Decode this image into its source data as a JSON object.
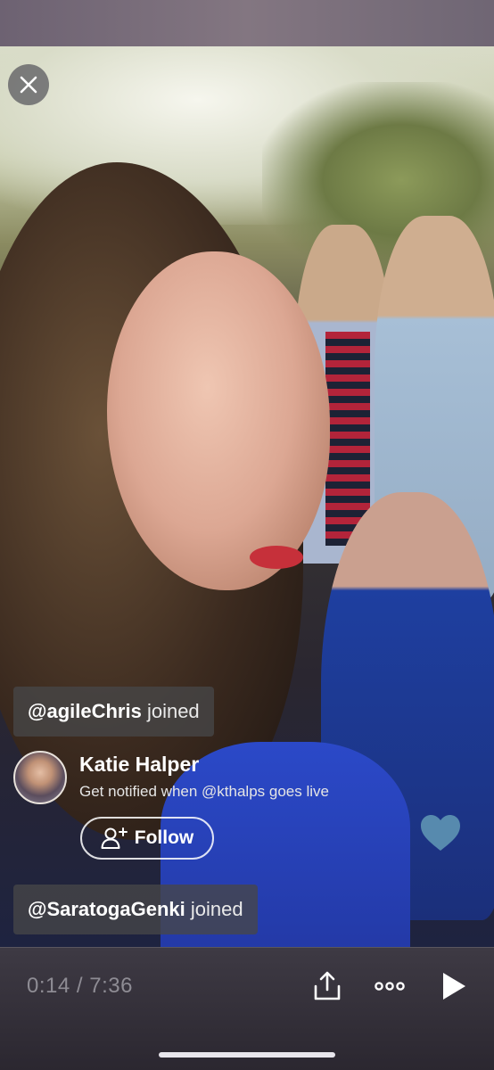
{
  "comments": [
    {
      "user": "@agileChris",
      "verb": "joined"
    },
    {
      "user": "@SaratogaGenki",
      "verb": "joined"
    }
  ],
  "host": {
    "name": "Katie Halper",
    "subtitle": "Get notified when @kthalps goes live",
    "follow_label": "Follow"
  },
  "player": {
    "time": "0:14 / 7:36"
  },
  "icons": {
    "close": "close-icon",
    "follow": "add-user-icon",
    "heart": "heart-icon",
    "share": "share-icon",
    "more": "more-icon",
    "play": "play-icon"
  },
  "colors": {
    "heart": "#5b8fb0",
    "chip_bg": "rgba(70,70,72,0.78)",
    "time_text": "#8e8c94"
  }
}
